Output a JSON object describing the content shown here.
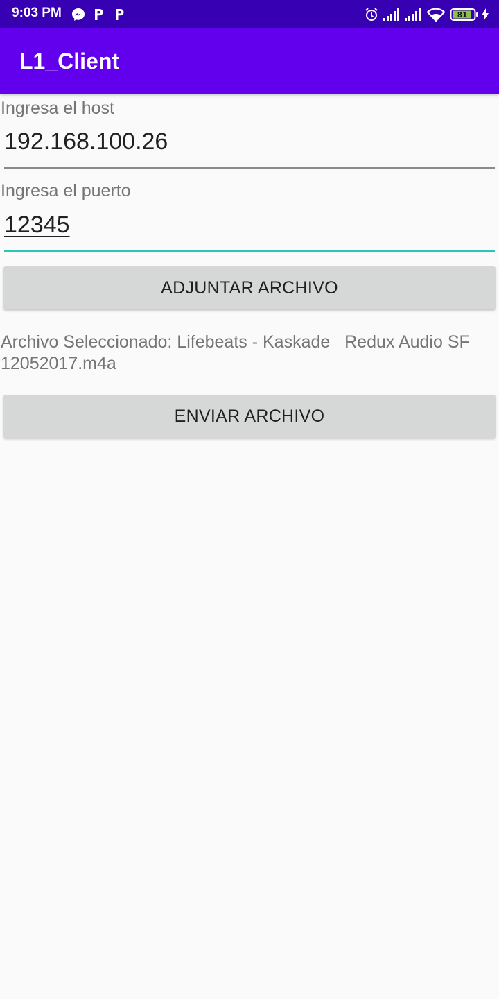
{
  "status_bar": {
    "time": "9:03 PM",
    "icons_left": [
      "messenger-icon",
      "p-icon",
      "p-icon"
    ],
    "icons_right": [
      "alarm-icon",
      "signal-icon",
      "signal-icon",
      "wifi-icon",
      "battery-icon",
      "charging-icon"
    ],
    "battery_level": "81"
  },
  "app_bar": {
    "title": "L1_Client"
  },
  "form": {
    "host_label": "Ingresa el host",
    "host_value": "192.168.100.26",
    "port_label": "Ingresa el puerto",
    "port_value": "12345"
  },
  "buttons": {
    "attach_label": "ADJUNTAR ARCHIVO",
    "send_label": "ENVIAR ARCHIVO"
  },
  "file_info": {
    "line1": "Archivo Seleccionado: Lifebeats - Kaskade   Redux Audio SF",
    "line2": "12052017.m4a"
  },
  "colors": {
    "status_bar": "#3700B3",
    "app_bar": "#6200EE",
    "accent": "#26C6B9",
    "background": "#FAFAFA",
    "button": "#D6D7D7"
  }
}
